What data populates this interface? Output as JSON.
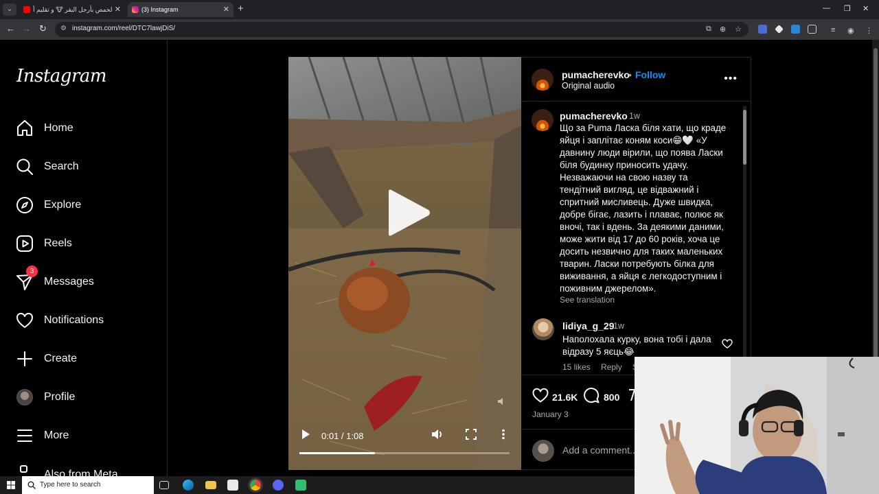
{
  "browser": {
    "tabs": [
      {
        "title": "الحمص بأرجل البقر 🐮 و تقليم أ...",
        "active": false
      },
      {
        "title": "(3) Instagram",
        "active": true
      }
    ],
    "url": "instagram.com/reel/DTC7lawjDiS/"
  },
  "sidebar": {
    "logo": "Instagram",
    "items": [
      {
        "label": "Home",
        "icon": "home-icon"
      },
      {
        "label": "Search",
        "icon": "search-icon"
      },
      {
        "label": "Explore",
        "icon": "compass-icon"
      },
      {
        "label": "Reels",
        "icon": "reels-icon"
      },
      {
        "label": "Messages",
        "icon": "messenger-icon",
        "badge": "3"
      },
      {
        "label": "Notifications",
        "icon": "heart-icon"
      },
      {
        "label": "Create",
        "icon": "plus-icon"
      },
      {
        "label": "Profile",
        "icon": "avatar"
      },
      {
        "label": "More",
        "icon": "menu-icon"
      },
      {
        "label": "Also from Meta",
        "icon": "meta-icon"
      }
    ]
  },
  "video": {
    "current_time": "0:01",
    "duration": "1:08",
    "time_display": "0:01 / 1:08",
    "progress_fraction": 0.36
  },
  "post": {
    "author": "pumacherevko",
    "follow_label": "Follow",
    "separator": "•",
    "audio": "Original audio",
    "caption_author": "pumacherevko",
    "caption_age": "1w",
    "caption": "Що за Puma Ласка біля хати, що краде яйця і заплітає коням коси😁🤍 «У давнину люди вірили, що поява Ласки біля будинку приносить удачу. Незважаючи на свою назву та тендітний вигляд, це відважний і спритний мисливець. Дуже швидка, добре бігає, лазить і плаває, полює як вночі, так і вдень. За деякими даними, може жити від 17 до 60 років, хоча це досить незвично для таких маленьких тварин. Ласки потребують білка для виживання, а яйця є легкодоступним і поживним джерелом».",
    "see_translation": "See translation",
    "comment": {
      "author": "lidiya_g_29",
      "age": "1w",
      "text": "Наполохала курку, вона тобі і дала відразу 5 яєць😂",
      "likes": "15 likes",
      "reply": "Reply",
      "see": "Se"
    },
    "likes": "21.6K",
    "comments": "800",
    "date": "January 3",
    "add_comment_placeholder": "Add a comment..."
  },
  "taskbar": {
    "search_placeholder": "Type here to search"
  },
  "colors": {
    "accent": "#0095f6",
    "badge": "#ff3040",
    "background": "#000000",
    "muted": "#a8a8a8"
  }
}
